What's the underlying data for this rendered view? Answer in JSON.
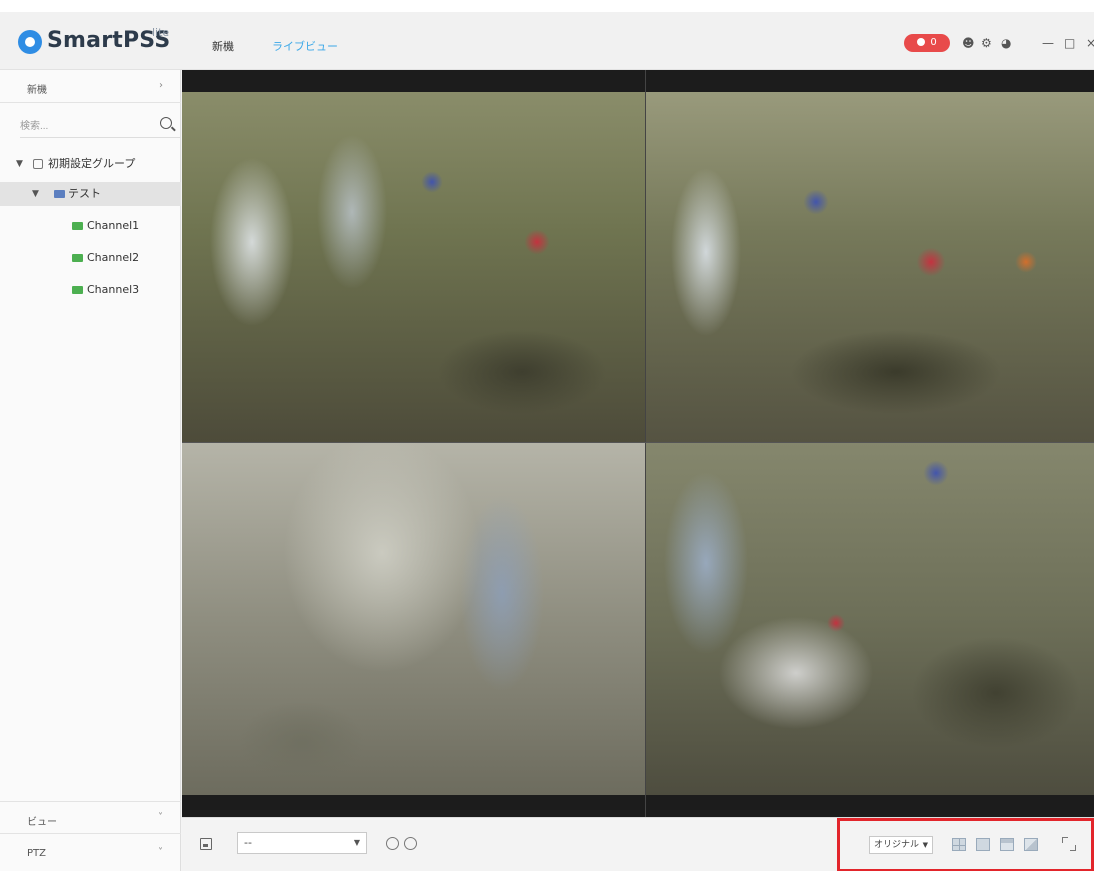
{
  "app": {
    "logo_text": "SmartPSS",
    "logo_sup": "lite",
    "tabs": [
      {
        "label": "新機",
        "active": false
      },
      {
        "label": "ライブビュー",
        "active": true
      }
    ],
    "alarm_count": "0"
  },
  "sidebar": {
    "device_section": "新機",
    "search_placeholder": "検索...",
    "tree": {
      "group": "初期設定グループ",
      "device": "テスト",
      "channels": [
        "Channel1",
        "Channel2",
        "Channel3"
      ]
    },
    "view_section": "ビュー",
    "ptz_section": "PTZ"
  },
  "bottombar": {
    "view_select": "--",
    "ratio_select": "オリジナル"
  },
  "colors": {
    "accent": "#3ba8e8",
    "alarm": "#e84a4a",
    "highlight_box": "#e2252b"
  }
}
